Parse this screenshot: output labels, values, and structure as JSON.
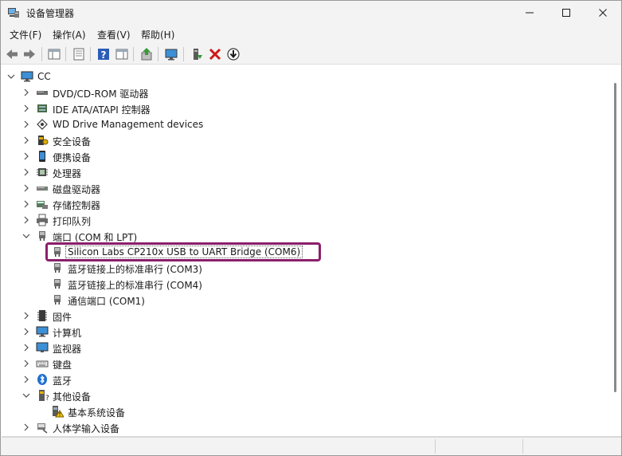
{
  "window": {
    "title": "设备管理器"
  },
  "menu": [
    "文件(F)",
    "操作(A)",
    "查看(V)",
    "帮助(H)"
  ],
  "toolbar": {
    "buttons": [
      {
        "name": "back-button",
        "icon": "arrow-left-icon"
      },
      {
        "name": "forward-button",
        "icon": "arrow-right-icon"
      },
      {
        "name": "show-hide-console-tree-button",
        "icon": "console-tree-icon"
      },
      {
        "name": "properties-button",
        "icon": "properties-icon"
      },
      {
        "name": "help-button",
        "icon": "help-icon"
      },
      {
        "name": "show-action-pane-button",
        "icon": "action-pane-icon"
      },
      {
        "name": "update-driver-button",
        "icon": "update-driver-icon"
      },
      {
        "name": "scan-hardware-button",
        "icon": "monitor-scan-icon"
      },
      {
        "name": "enable-device-button",
        "icon": "enable-device-icon"
      },
      {
        "name": "uninstall-device-button",
        "icon": "red-x-icon"
      },
      {
        "name": "disable-device-button",
        "icon": "down-arrow-circle-icon"
      }
    ]
  },
  "tree": {
    "root": "CC",
    "rows": [
      {
        "label": "CC",
        "level": 0,
        "expanded": true,
        "icon": "computer-icon"
      },
      {
        "label": "DVD/CD-ROM 驱动器",
        "level": 1,
        "expanded": false,
        "icon": "dvd-drive-icon"
      },
      {
        "label": "IDE ATA/ATAPI 控制器",
        "level": 1,
        "expanded": false,
        "icon": "ide-controller-icon"
      },
      {
        "label": "WD Drive Management devices",
        "level": 1,
        "expanded": false,
        "icon": "wd-device-icon"
      },
      {
        "label": "安全设备",
        "level": 1,
        "expanded": false,
        "icon": "security-device-icon"
      },
      {
        "label": "便携设备",
        "level": 1,
        "expanded": false,
        "icon": "portable-device-icon"
      },
      {
        "label": "处理器",
        "level": 1,
        "expanded": false,
        "icon": "processor-icon"
      },
      {
        "label": "磁盘驱动器",
        "level": 1,
        "expanded": false,
        "icon": "disk-drive-icon"
      },
      {
        "label": "存储控制器",
        "level": 1,
        "expanded": false,
        "icon": "storage-controller-icon"
      },
      {
        "label": "打印队列",
        "level": 1,
        "expanded": false,
        "icon": "printer-icon"
      },
      {
        "label": "端口 (COM 和 LPT)",
        "level": 1,
        "expanded": true,
        "icon": "port-icon"
      },
      {
        "label": "Silicon Labs CP210x USB to UART Bridge (COM6)",
        "level": 2,
        "selected": true,
        "icon": "port-icon"
      },
      {
        "label": "蓝牙链接上的标准串行 (COM3)",
        "level": 2,
        "icon": "port-icon"
      },
      {
        "label": "蓝牙链接上的标准串行 (COM4)",
        "level": 2,
        "icon": "port-icon"
      },
      {
        "label": "通信端口 (COM1)",
        "level": 2,
        "icon": "port-icon"
      },
      {
        "label": "固件",
        "level": 1,
        "expanded": false,
        "icon": "firmware-icon"
      },
      {
        "label": "计算机",
        "level": 1,
        "expanded": false,
        "icon": "computer-icon"
      },
      {
        "label": "监视器",
        "level": 1,
        "expanded": false,
        "icon": "monitor-icon"
      },
      {
        "label": "键盘",
        "level": 1,
        "expanded": false,
        "icon": "keyboard-icon"
      },
      {
        "label": "蓝牙",
        "level": 1,
        "expanded": false,
        "icon": "bluetooth-icon"
      },
      {
        "label": "其他设备",
        "level": 1,
        "expanded": true,
        "icon": "other-device-icon"
      },
      {
        "label": "基本系统设备",
        "level": 2,
        "icon": "warning-device-icon"
      },
      {
        "label": "人体学输入设备",
        "level": 1,
        "expanded": false,
        "icon": "hid-icon"
      }
    ]
  },
  "colors": {
    "highlight_border": "#8b1f6b",
    "accent": "#1f5fbf"
  }
}
